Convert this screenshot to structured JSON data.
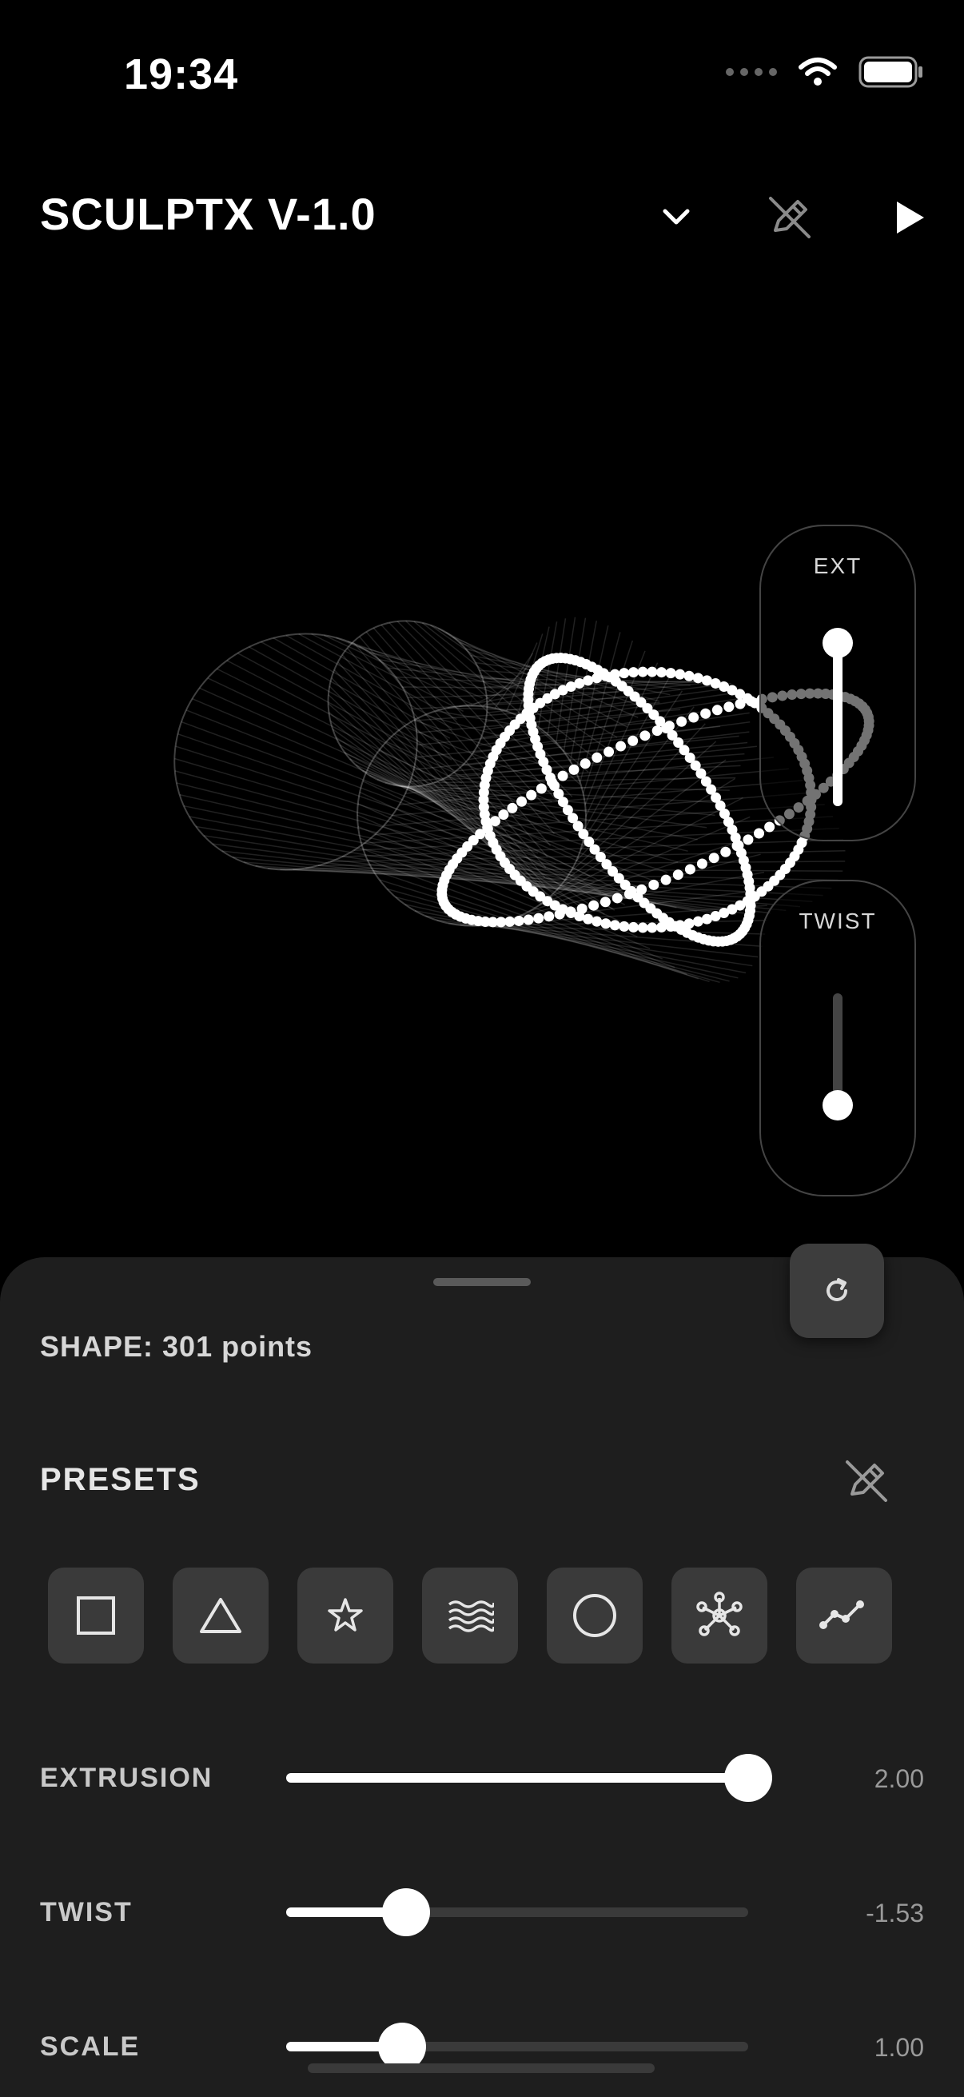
{
  "status_bar": {
    "time": "19:34",
    "icons": [
      "signal-dots-icon",
      "wifi-icon",
      "battery-icon"
    ]
  },
  "header": {
    "title": "SCULPTX V-1.0",
    "buttons": [
      "chevron-down-icon",
      "pencil-off-icon",
      "play-icon"
    ]
  },
  "overlay_sliders": {
    "ext": {
      "label": "EXT",
      "level": 0.92
    },
    "twist": {
      "label": "TWIST",
      "level": 0.08
    }
  },
  "sheet": {
    "shape_info": "SHAPE: 301 points",
    "presets_title": "PRESETS",
    "presets_icon": "pencil-off-icon",
    "presets": [
      {
        "name": "square-icon"
      },
      {
        "name": "triangle-icon"
      },
      {
        "name": "star-icon"
      },
      {
        "name": "waves-icon"
      },
      {
        "name": "circle-icon"
      },
      {
        "name": "network-icon"
      },
      {
        "name": "line-graph-icon"
      }
    ],
    "sliders": [
      {
        "label": "EXTRUSION",
        "value": "2.00",
        "fraction": 1.0
      },
      {
        "label": "TWIST",
        "value": "-1.53",
        "fraction": 0.26
      },
      {
        "label": "SCALE",
        "value": "1.00",
        "fraction": 0.25
      }
    ]
  },
  "colors": {
    "background": "#000000",
    "sheet": "#1e1e1e",
    "accent": "#ffffff",
    "preset_tile": "#3a3a3a"
  }
}
